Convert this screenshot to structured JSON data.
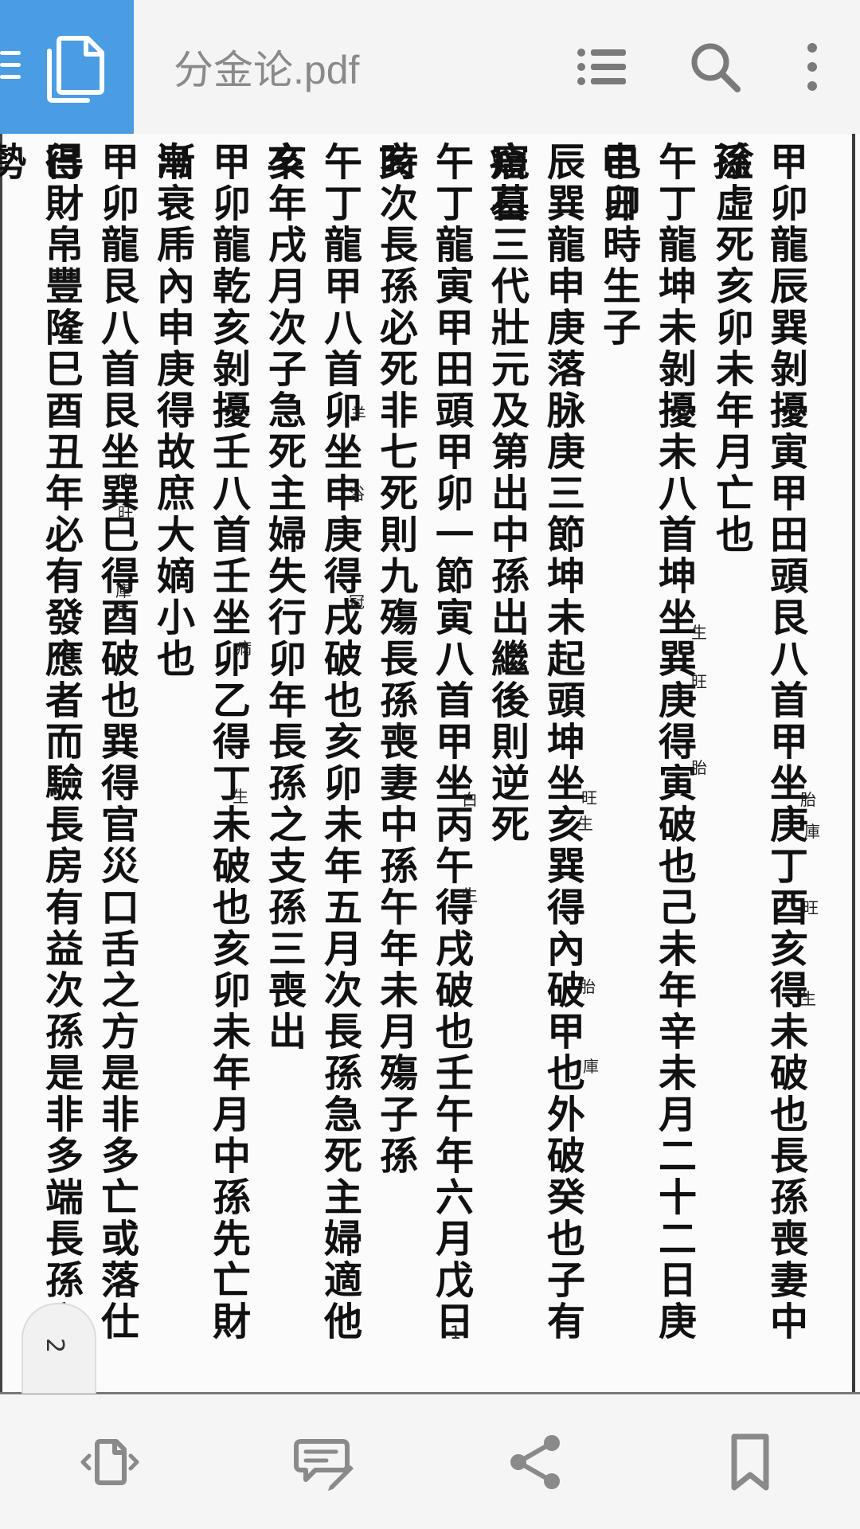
{
  "app": {
    "title": "分金论.pdf",
    "accent_color": "#4a9de3",
    "icons": [
      "menu-icon",
      "documents-icon",
      "list-icon",
      "search-icon",
      "more-vert-icon"
    ]
  },
  "document": {
    "columns": [
      "甲卯龍辰巽剝擾寅甲田頭艮八首甲坐庚丁酉亥得未破也長孫喪妻中孫",
      "淦虛死亥卯未年月亡也",
      "午丁龍坤未剝擾未八首坤坐巽庚得寅破也己未年辛未月二十二日庚申日",
      "己卯時生子",
      "辰巽龍申庚落脉庚三節坤未起頭坤坐亥巽得內破甲也外破癸也子有瘖石",
      "窺墓三代壯元及第出中孫出繼後則逆死",
      "午丁龍寅甲田頭甲卯一節寅八首甲坐丙午得戌破也壬午年六月戊日亥",
      "時次長孫必死非七死則九殤長孫喪妻中孫午年未月殤子孫",
      "午丁龍甲八首卯坐申庚得戌破也亥卯未年五月次長孫急死主婦適他卒",
      "亥年戌月次子急死主婦失行卯年長孫之支孫三喪出",
      "甲卯龍乾亥剝擾壬八首壬坐卯乙得丁未破也亥卯未年月中孫先亡財帛",
      "漸衰乕內申庚得故庶大嫡小也",
      "甲卯龍艮八首艮坐巽巳得酉破也巽得官災口舌之方是非多亡或落仕巳",
      "得財帛豐隆巳酉丑年必有發應者而驗長房有益次孫是非多端長孫亡勢"
    ],
    "annotations": [
      "胎",
      "庫",
      "旺",
      "生",
      "生",
      "旺",
      "胎",
      "旺",
      "生",
      "白",
      "胎",
      "庫",
      "羊",
      "浴",
      "冠",
      "生",
      "病",
      "生",
      "官",
      "旺",
      "庫",
      "旺"
    ],
    "page_number": "1"
  },
  "page_tab": {
    "label": "2"
  },
  "bottom_bar": {
    "buttons": [
      "page-swap-icon",
      "comment-edit-icon",
      "share-icon",
      "bookmark-icon"
    ]
  }
}
